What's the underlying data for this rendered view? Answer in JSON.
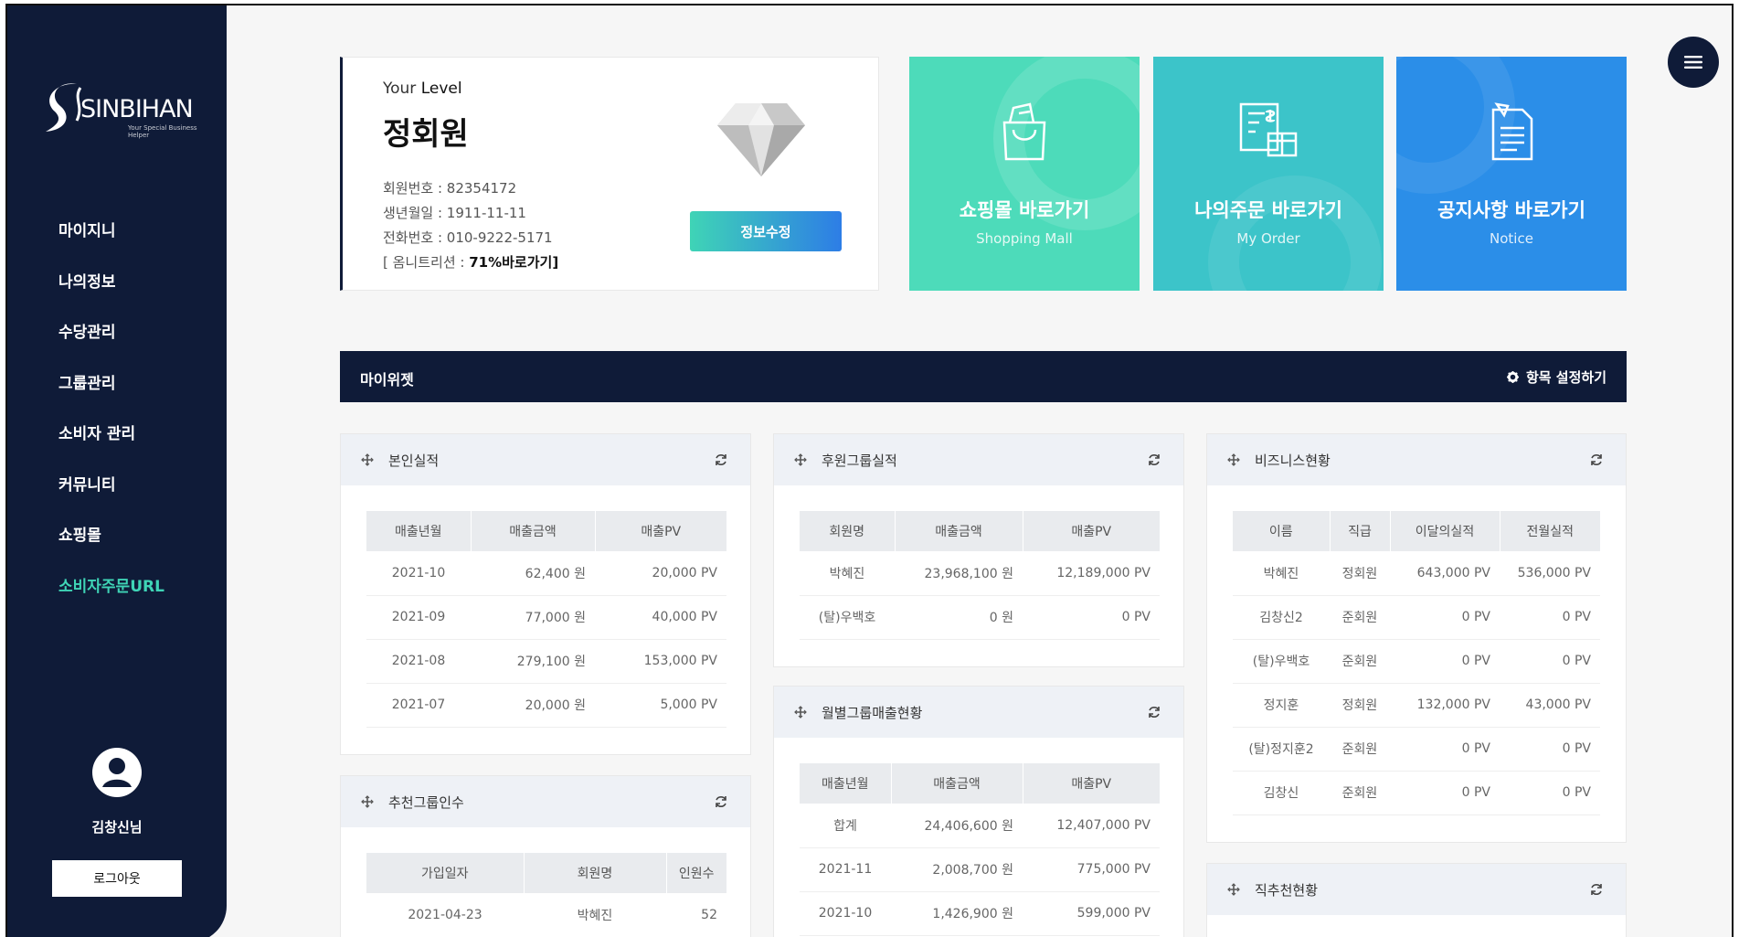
{
  "sidebar": {
    "logo": {
      "brand": "SINBIHAN",
      "tagline": "Your Special Business Helper"
    },
    "menu": [
      {
        "label": "마이지니",
        "active": false
      },
      {
        "label": "나의정보",
        "active": false
      },
      {
        "label": "수당관리",
        "active": false
      },
      {
        "label": "그룹관리",
        "active": false
      },
      {
        "label": "소비자 관리",
        "active": false
      },
      {
        "label": "커뮤니티",
        "active": false
      },
      {
        "label": "쇼핑몰",
        "active": false
      },
      {
        "label": "소비자주문URL",
        "active": true
      }
    ],
    "user_name": "김창신님",
    "logout_label": "로그아웃"
  },
  "level": {
    "title_prefix": "Your ",
    "title_bold": "Level",
    "name": "정회원",
    "member_no": "회원번호 : 82354172",
    "birth": "생년월일 : 1911-11-11",
    "phone": "전화번호 : 010-9222-5171",
    "omni_prefix": "[ 옴니트리션 : ",
    "omni_value": "71%바로가기]",
    "edit_label": "정보수정"
  },
  "tiles": {
    "shop": {
      "title": "쇼핑몰 바로가기",
      "subtitle": "Shopping Mall",
      "icon": "shopping-bag-icon",
      "color": "#4ddbba"
    },
    "order": {
      "title": "나의주문 바로가기",
      "subtitle": "My Order",
      "icon": "invoice-icon",
      "color": "#3cc4c9"
    },
    "notice": {
      "title": "공지사항 바로가기",
      "subtitle": "Notice",
      "icon": "notice-document-icon",
      "color": "#2b8ee8"
    }
  },
  "widget_bar": {
    "title": "마이위젯",
    "settings_label": "항목 설정하기"
  },
  "panels": {
    "own": {
      "title": "본인실적",
      "headers": [
        "매출년월",
        "매출금액",
        "매출PV"
      ],
      "rows": [
        [
          "2021-10",
          "62,400 원",
          "20,000 PV"
        ],
        [
          "2021-09",
          "77,000 원",
          "40,000 PV"
        ],
        [
          "2021-08",
          "279,100 원",
          "153,000 PV"
        ],
        [
          "2021-07",
          "20,000 원",
          "5,000 PV"
        ]
      ]
    },
    "recommend": {
      "title": "추천그룹인수",
      "headers": [
        "가입일자",
        "회원명",
        "인원수"
      ],
      "rows": [
        [
          "2021-04-23",
          "박혜진",
          "52"
        ]
      ]
    },
    "sponsor": {
      "title": "후원그룹실적",
      "headers": [
        "회원명",
        "매출금액",
        "매출PV"
      ],
      "rows": [
        [
          "박혜진",
          "23,968,100 원",
          "12,189,000 PV"
        ],
        [
          "(탈)우백호",
          "0 원",
          "0 PV"
        ]
      ]
    },
    "monthly": {
      "title": "월별그룹매출현황",
      "headers": [
        "매출년월",
        "매출금액",
        "매출PV"
      ],
      "rows": [
        [
          "합계",
          "24,406,600 원",
          "12,407,000 PV"
        ],
        [
          "2021-11",
          "2,008,700 원",
          "775,000 PV"
        ],
        [
          "2021-10",
          "1,426,900 원",
          "599,000 PV"
        ]
      ]
    },
    "business": {
      "title": "비즈니스현황",
      "headers": [
        "이름",
        "직급",
        "이달의실적",
        "전월실적"
      ],
      "rows": [
        [
          "박혜진",
          "정회원",
          "643,000 PV",
          "536,000 PV"
        ],
        [
          "김창신2",
          "준회원",
          "0 PV",
          "0 PV"
        ],
        [
          "(탈)우백호",
          "준회원",
          "0 PV",
          "0 PV"
        ],
        [
          "정지훈",
          "정회원",
          "132,000 PV",
          "43,000 PV"
        ],
        [
          "(탈)정지훈2",
          "준회원",
          "0 PV",
          "0 PV"
        ],
        [
          "김창신",
          "준회원",
          "0 PV",
          "0 PV"
        ]
      ]
    },
    "direct": {
      "title": "직추천현황"
    }
  },
  "icons": {
    "move": "move-cross-icon",
    "refresh": "refresh-icon",
    "settings": "gear-icon",
    "menu": "hamburger-menu-icon",
    "level": "diamond-icon",
    "user": "user-avatar-icon"
  }
}
